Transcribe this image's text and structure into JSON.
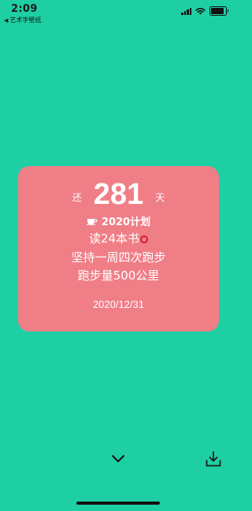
{
  "status_bar": {
    "time": "2:09",
    "back_app": "艺术字壁纸",
    "battery_level": 0.9
  },
  "card": {
    "prefix": "还",
    "count": "281",
    "suffix": "天",
    "plan_title": "2020计划",
    "goals": [
      "读24本书",
      "坚持一周四次跑步",
      "跑步量500公里"
    ],
    "goal_1_emoji": "red-circle-icon",
    "date": "2020/12/31",
    "background": "#f07e87"
  },
  "colors": {
    "page_background": "#1ecfa3"
  },
  "icons": {
    "expand": "chevron-down-icon",
    "download": "download-icon"
  }
}
